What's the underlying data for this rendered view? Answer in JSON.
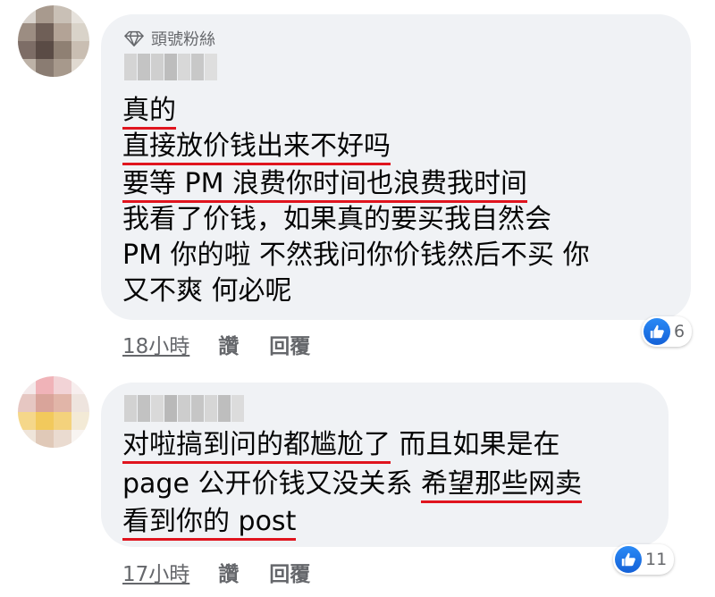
{
  "comments": [
    {
      "badge": "頭號粉絲",
      "lines": [
        "真的",
        "直接放价钱出来不好吗",
        "要等 PM 浪费你时间也浪费我时间",
        "我看了价钱，如果真的要买我自然会",
        "PM 你的啦 不然我问你价钱然后不买  你",
        "又不爽 何必呢"
      ],
      "time": "18小時",
      "like_label": "讚",
      "reply_label": "回覆",
      "reaction_count": "6",
      "reaction_icon": "like-icon"
    },
    {
      "line1_underlined": "对啦搞到问的都尴尬了",
      "line1_rest": " 而且如果是在",
      "line2_plain": "page 公开价钱又没关系 ",
      "line2_underlined": "希望那些网卖",
      "line3_underlined": "看到你的 post",
      "time": "17小時",
      "like_label": "讚",
      "reply_label": "回覆",
      "reaction_count": "11",
      "reaction_icon": "like-icon"
    }
  ],
  "colors": {
    "bubble": "#f0f2f5",
    "underline": "#e0141e",
    "meta_text": "#65676b",
    "like_blue": "#1877f2"
  }
}
